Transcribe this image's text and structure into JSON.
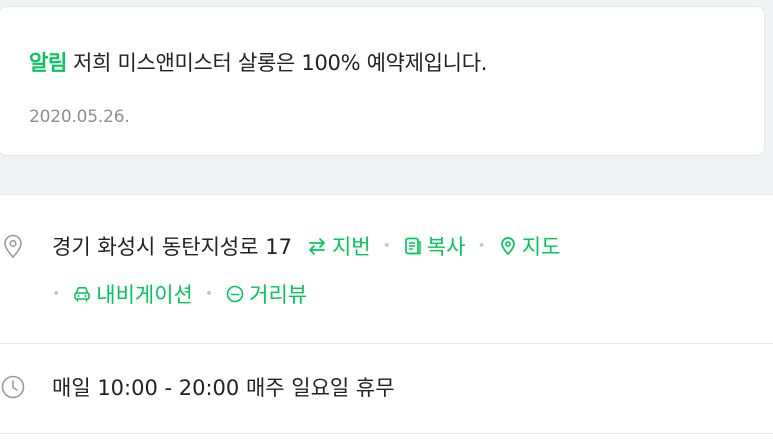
{
  "notice": {
    "tag": "알림",
    "text": "저희 미스앤미스터 살롱은 100% 예약제입니다.",
    "date": "2020.05.26."
  },
  "location": {
    "address": "경기 화성시 동탄지성로 17",
    "actions": {
      "lot_number": "지번",
      "copy": "복사",
      "map": "지도",
      "navigation": "내비게이션",
      "street_view": "거리뷰"
    },
    "separator": "•"
  },
  "hours": {
    "text": "매일 10:00 - 20:00 매주 일요일 휴무"
  },
  "colors": {
    "accent": "#03c75a",
    "text": "#222222",
    "muted": "#8e8e93",
    "background": "#f1f2f4"
  },
  "icons": {
    "address": "location-pin-icon",
    "lot_number": "swap-arrows-icon",
    "copy": "copy-icon",
    "map": "map-pin-icon",
    "navigation": "car-icon",
    "street_view": "street-view-icon",
    "hours": "clock-icon"
  }
}
